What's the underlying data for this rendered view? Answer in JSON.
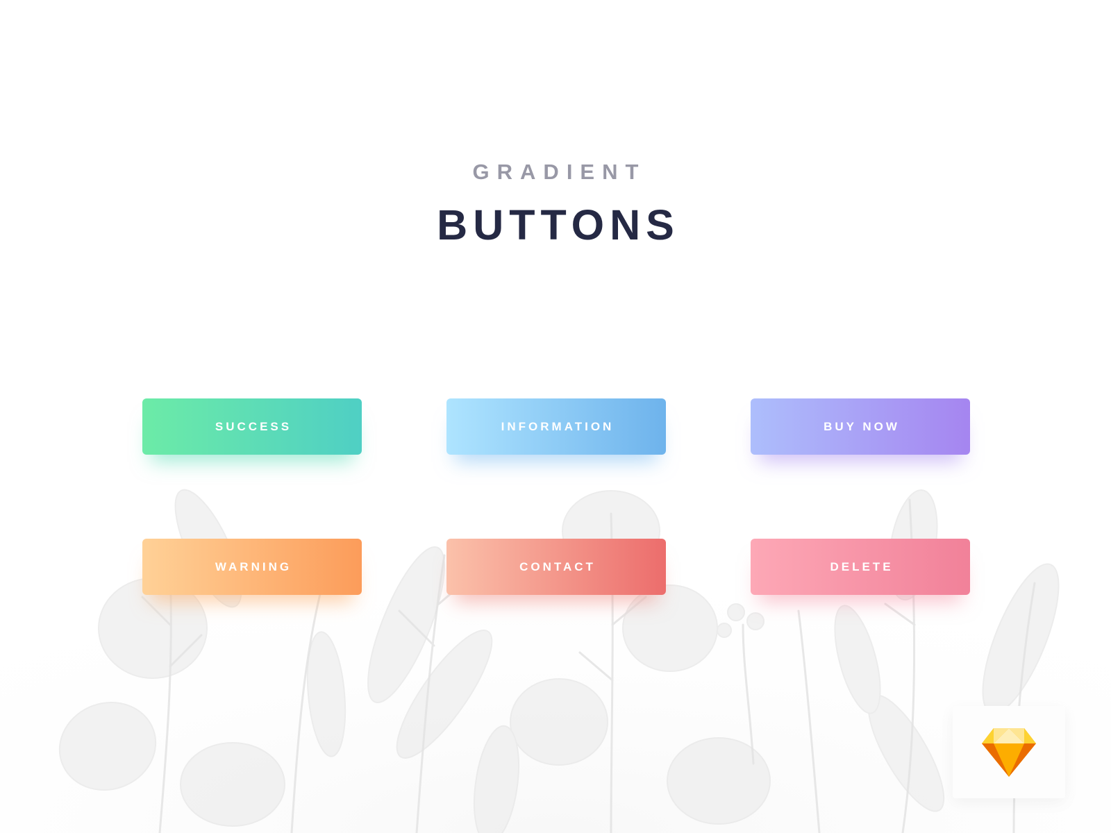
{
  "header": {
    "eyebrow": "GRADIENT",
    "title": "BUTTONS"
  },
  "colors": {
    "eyebrow_text": "#9898a6",
    "title_text": "#252944",
    "button_text": "#ffffff",
    "background": "#ffffff"
  },
  "buttons": [
    {
      "label": "SUCCESS",
      "gradient": [
        "#6ceba7",
        "#4fcfc4"
      ]
    },
    {
      "label": "INFORMATION",
      "gradient": [
        "#aee4ff",
        "#6eb3ec"
      ]
    },
    {
      "label": "BUY NOW",
      "gradient": [
        "#adbefc",
        "#a585f0"
      ]
    },
    {
      "label": "WARNING",
      "gradient": [
        "#ffd197",
        "#fc9c5a"
      ]
    },
    {
      "label": "CONTACT",
      "gradient": [
        "#fbc1aa",
        "#ec6d6c"
      ]
    },
    {
      "label": "DELETE",
      "gradient": [
        "#fda8b6",
        "#f18199"
      ]
    }
  ],
  "badge": {
    "icon": "sketch-diamond-icon"
  }
}
